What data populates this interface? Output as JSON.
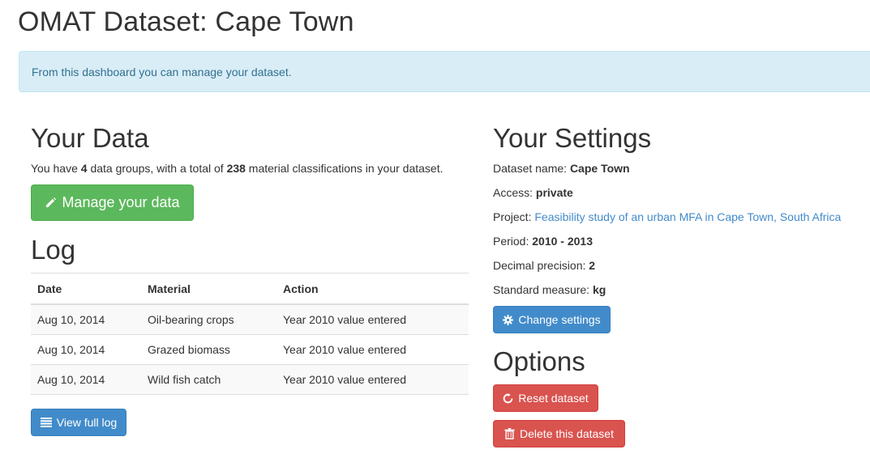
{
  "page": {
    "title": "OMAT Dataset: Cape Town"
  },
  "alert": {
    "text": "From this dashboard you can manage your dataset."
  },
  "your_data": {
    "heading": "Your Data",
    "summary_prefix": "You have ",
    "groups_count": "4",
    "summary_mid": " data groups, with a total of ",
    "classifications_count": "238",
    "summary_suffix": " material classifications in your dataset.",
    "manage_button": "Manage your data",
    "manage_icon": "pencil-icon"
  },
  "log": {
    "heading": "Log",
    "columns": [
      "Date",
      "Material",
      "Action"
    ],
    "rows": [
      [
        "Aug 10, 2014",
        "Oil-bearing crops",
        "Year 2010 value entered"
      ],
      [
        "Aug 10, 2014",
        "Grazed biomass",
        "Year 2010 value entered"
      ],
      [
        "Aug 10, 2014",
        "Wild fish catch",
        "Year 2010 value entered"
      ]
    ],
    "view_button": "View full log",
    "view_icon": "list-icon"
  },
  "settings": {
    "heading": "Your Settings",
    "dataset_name_label": "Dataset name: ",
    "dataset_name": "Cape Town",
    "access_label": "Access: ",
    "access": "private",
    "project_label": "Project: ",
    "project": "Feasibility study of an urban MFA in Cape Town, South Africa",
    "period_label": "Period: ",
    "period": "2010 - 2013",
    "decimal_label": "Decimal precision: ",
    "decimal": "2",
    "measure_label": "Standard measure: ",
    "measure": "kg",
    "change_button": "Change settings",
    "change_icon": "gear-icon"
  },
  "options": {
    "heading": "Options",
    "reset_button": "Reset dataset",
    "reset_icon": "refresh-icon",
    "delete_button": "Delete this dataset",
    "delete_icon": "trash-icon"
  },
  "colors": {
    "success": "#5cb85c",
    "primary": "#428bca",
    "danger": "#d9534f",
    "alert_bg": "#d9edf7",
    "alert_text": "#31708f",
    "link": "#428bca"
  }
}
